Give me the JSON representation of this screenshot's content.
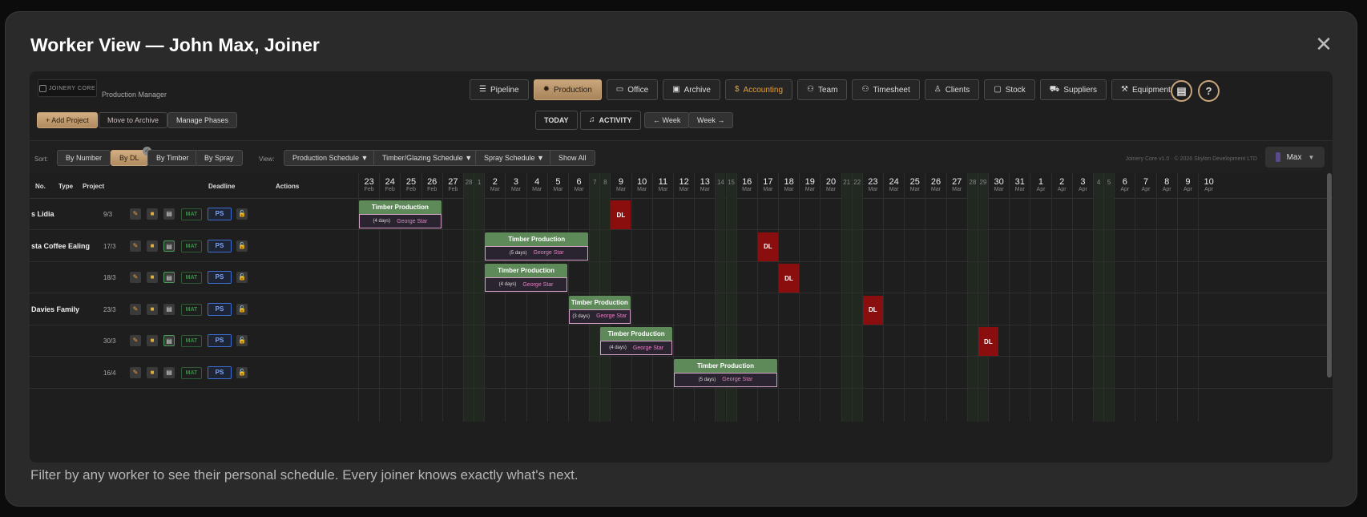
{
  "modal": {
    "title": "Worker View — John Max, Joiner",
    "close": "✕",
    "caption": "Filter by any worker to see their personal schedule. Every joiner knows exactly what's next."
  },
  "app": {
    "logo": "JOINERY CORE",
    "subtitle": "Production Manager",
    "nav": [
      {
        "label": "Pipeline",
        "icon": "list-icon"
      },
      {
        "label": "Production",
        "icon": "gear-icon"
      },
      {
        "label": "Office",
        "icon": "folder-icon"
      },
      {
        "label": "Archive",
        "icon": "archive-icon"
      },
      {
        "label": "Accounting",
        "icon": "dollar-icon"
      },
      {
        "label": "Team",
        "icon": "team-icon"
      },
      {
        "label": "Timesheet",
        "icon": "users-icon"
      },
      {
        "label": "Clients",
        "icon": "user-icon"
      },
      {
        "label": "Stock",
        "icon": "box-icon"
      },
      {
        "label": "Suppliers",
        "icon": "truck-icon"
      },
      {
        "label": "Equipment",
        "icon": "wrench-icon"
      }
    ],
    "calculator_icon": "calculator-icon",
    "help": "?",
    "actions": {
      "add_project": "+ Add Project",
      "move_archive": "Move to Archive",
      "manage_phases": "Manage Phases",
      "today": "TODAY",
      "activity": "ACTIVITY",
      "prev_week": "← Week",
      "next_week": "Week →"
    },
    "sort": {
      "label": "Sort:",
      "options": [
        "By Number",
        "By DL",
        "By Timber",
        "By Spray"
      ],
      "selected": "By DL",
      "view_label": "View:",
      "views": [
        "Production Schedule ▼",
        "Timber/Glazing Schedule ▼",
        "Spray Schedule ▼",
        "Show All"
      ],
      "footer": "Joinery Core v1.0 · © 2026 Skylon Development LTD",
      "user": "Max"
    },
    "columns": {
      "no": "No.",
      "type": "Type",
      "project": "Project",
      "deadline": "Deadline",
      "actions": "Actions"
    },
    "days": [
      {
        "d": "23",
        "m": "Feb"
      },
      {
        "d": "24",
        "m": "Feb"
      },
      {
        "d": "25",
        "m": "Feb"
      },
      {
        "d": "26",
        "m": "Feb"
      },
      {
        "d": "27",
        "m": "Feb"
      },
      {
        "d": "28",
        "m": "",
        "we": true
      },
      {
        "d": "1",
        "m": "",
        "we": true
      },
      {
        "d": "2",
        "m": "Mar"
      },
      {
        "d": "3",
        "m": "Mar"
      },
      {
        "d": "4",
        "m": "Mar"
      },
      {
        "d": "5",
        "m": "Mar"
      },
      {
        "d": "6",
        "m": "Mar"
      },
      {
        "d": "7",
        "m": "",
        "we": true
      },
      {
        "d": "8",
        "m": "",
        "we": true
      },
      {
        "d": "9",
        "m": "Mar"
      },
      {
        "d": "10",
        "m": "Mar"
      },
      {
        "d": "11",
        "m": "Mar"
      },
      {
        "d": "12",
        "m": "Mar"
      },
      {
        "d": "13",
        "m": "Mar"
      },
      {
        "d": "14",
        "m": "",
        "we": true
      },
      {
        "d": "15",
        "m": "",
        "we": true
      },
      {
        "d": "16",
        "m": "Mar"
      },
      {
        "d": "17",
        "m": "Mar"
      },
      {
        "d": "18",
        "m": "Mar"
      },
      {
        "d": "19",
        "m": "Mar"
      },
      {
        "d": "20",
        "m": "Mar"
      },
      {
        "d": "21",
        "m": "",
        "we": true
      },
      {
        "d": "22",
        "m": "",
        "we": true
      },
      {
        "d": "23",
        "m": "Mar"
      },
      {
        "d": "24",
        "m": "Mar"
      },
      {
        "d": "25",
        "m": "Mar"
      },
      {
        "d": "26",
        "m": "Mar"
      },
      {
        "d": "27",
        "m": "Mar"
      },
      {
        "d": "28",
        "m": "",
        "we": true
      },
      {
        "d": "29",
        "m": "",
        "we": true
      },
      {
        "d": "30",
        "m": "Mar"
      },
      {
        "d": "31",
        "m": "Mar"
      },
      {
        "d": "1",
        "m": "Apr"
      },
      {
        "d": "2",
        "m": "Apr"
      },
      {
        "d": "3",
        "m": "Apr"
      },
      {
        "d": "4",
        "m": "",
        "we": true
      },
      {
        "d": "5",
        "m": "",
        "we": true
      },
      {
        "d": "6",
        "m": "Apr"
      },
      {
        "d": "7",
        "m": "Apr"
      },
      {
        "d": "8",
        "m": "Apr"
      },
      {
        "d": "9",
        "m": "Apr"
      },
      {
        "d": "10",
        "m": "Apr"
      }
    ],
    "rows": [
      {
        "name": "s Lidia",
        "deadline": "9/3",
        "doc_on": false,
        "task": "Timber Production",
        "duration": "(4 days)",
        "worker": "George Star",
        "start": 0,
        "span": 4,
        "dl": 14
      },
      {
        "name": "sta Coffee Ealing",
        "deadline": "17/3",
        "doc_on": true,
        "task": "Timber Production",
        "duration": "(5 days)",
        "worker": "George Star",
        "start": 7,
        "span": 5,
        "dl": 22
      },
      {
        "name": "",
        "deadline": "18/3",
        "doc_on": true,
        "task": "Timber Production",
        "duration": "(4 days)",
        "worker": "George Star",
        "start": 7,
        "span": 4,
        "dl": 23
      },
      {
        "name": "Davies Family",
        "deadline": "23/3",
        "doc_on": false,
        "task": "Timber Production",
        "duration": "(3 days)",
        "worker": "George Star",
        "start": 11,
        "span": 4,
        "dl": 28
      },
      {
        "name": "",
        "deadline": "30/3",
        "doc_on": true,
        "task": "Timber Production",
        "duration": "(4 days)",
        "worker": "George Star",
        "start": 13,
        "span": 4,
        "dl": 34
      },
      {
        "name": "",
        "deadline": "16/4",
        "doc_on": false,
        "task": "Timber Production",
        "duration": "(5 days)",
        "worker": "George Star",
        "start": 17,
        "span": 6,
        "dl": null
      }
    ],
    "dl_label": "DL",
    "mat_label": "MAT",
    "ps_label": "PS"
  }
}
